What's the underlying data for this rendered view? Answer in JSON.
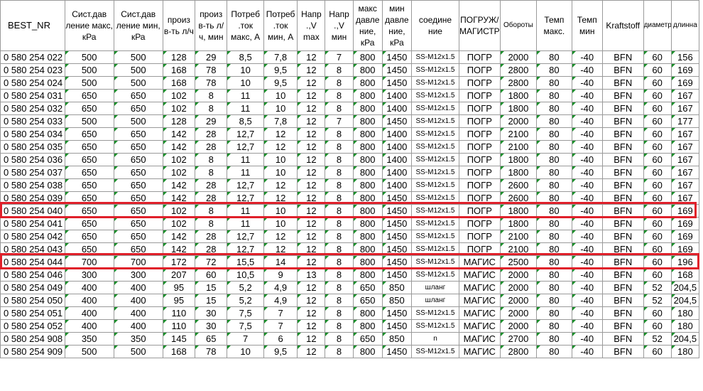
{
  "headers": [
    "BEST_NR",
    "Сист.дав ление макс, кРа",
    "Сист.дав ление мин, кРа",
    "произ в-ть л/ч",
    "произ в-ть л/ч, мин",
    "Потреб .ток макс, А",
    "Потреб .ток мин, А",
    "Напр .,V max",
    "Напр .,V мин",
    "макс давле ние, кРа",
    "мин давле ние, кРа",
    "соедине ние",
    "ПОГРУЖ/ МАГИСТР",
    "Обороты",
    "Темп макс.",
    "Темп мин",
    "Kraftstoff",
    "диаметр",
    "длинна"
  ],
  "rows": [
    [
      "0 580 254 022",
      "500",
      "500",
      "128",
      "29",
      "8,5",
      "7,8",
      "12",
      "7",
      "800",
      "1450",
      "SS-M12x1.5",
      "ПОГР",
      "2000",
      "80",
      "-40",
      "BFN",
      "60",
      "156"
    ],
    [
      "0 580 254 023",
      "500",
      "500",
      "168",
      "78",
      "10",
      "9,5",
      "12",
      "8",
      "800",
      "1450",
      "SS-M12x1.5",
      "ПОГР",
      "2800",
      "80",
      "-40",
      "BFN",
      "60",
      "169"
    ],
    [
      "0 580 254 024",
      "500",
      "500",
      "168",
      "78",
      "10",
      "9,5",
      "12",
      "8",
      "800",
      "1450",
      "SS-M12x1.5",
      "ПОГР",
      "2800",
      "80",
      "-40",
      "BFN",
      "60",
      "169"
    ],
    [
      "0 580 254 031",
      "650",
      "650",
      "102",
      "8",
      "11",
      "10",
      "12",
      "8",
      "800",
      "1400",
      "SS-M12x1.5",
      "ПОГР",
      "1800",
      "80",
      "-40",
      "BFN",
      "60",
      "167"
    ],
    [
      "0 580 254 032",
      "650",
      "650",
      "102",
      "8",
      "11",
      "10",
      "12",
      "8",
      "800",
      "1400",
      "SS-M12x1.5",
      "ПОГР",
      "1800",
      "80",
      "-40",
      "BFN",
      "60",
      "167"
    ],
    [
      "0 580 254 033",
      "500",
      "500",
      "128",
      "29",
      "8,5",
      "7,8",
      "12",
      "7",
      "800",
      "1450",
      "SS-M12x1.5",
      "ПОГР",
      "2000",
      "80",
      "-40",
      "BFN",
      "60",
      "177"
    ],
    [
      "0 580 254 034",
      "650",
      "650",
      "142",
      "28",
      "12,7",
      "12",
      "12",
      "8",
      "800",
      "1400",
      "SS-M12x1.5",
      "ПОГР",
      "2100",
      "80",
      "-40",
      "BFN",
      "60",
      "167"
    ],
    [
      "0 580 254 035",
      "650",
      "650",
      "142",
      "28",
      "12,7",
      "12",
      "12",
      "8",
      "800",
      "1400",
      "SS-M12x1.5",
      "ПОГР",
      "2100",
      "80",
      "-40",
      "BFN",
      "60",
      "167"
    ],
    [
      "0 580 254 036",
      "650",
      "650",
      "102",
      "8",
      "11",
      "10",
      "12",
      "8",
      "800",
      "1400",
      "SS-M12x1.5",
      "ПОГР",
      "1800",
      "80",
      "-40",
      "BFN",
      "60",
      "167"
    ],
    [
      "0 580 254 037",
      "650",
      "650",
      "102",
      "8",
      "11",
      "10",
      "12",
      "8",
      "800",
      "1400",
      "SS-M12x1.5",
      "ПОГР",
      "1800",
      "80",
      "-40",
      "BFN",
      "60",
      "167"
    ],
    [
      "0 580 254 038",
      "650",
      "650",
      "142",
      "28",
      "12,7",
      "12",
      "12",
      "8",
      "800",
      "1400",
      "SS-M12x1.5",
      "ПОГР",
      "2600",
      "80",
      "-40",
      "BFN",
      "60",
      "167"
    ],
    [
      "0 580 254 039",
      "650",
      "650",
      "142",
      "28",
      "12,7",
      "12",
      "12",
      "8",
      "800",
      "1450",
      "SS-M12x1.5",
      "ПОГР",
      "2600",
      "80",
      "-40",
      "BFN",
      "60",
      "167"
    ],
    [
      "0 580 254 040",
      "650",
      "650",
      "102",
      "8",
      "11",
      "10",
      "12",
      "8",
      "800",
      "1450",
      "SS-M12x1.5",
      "ПОГР",
      "1800",
      "80",
      "-40",
      "BFN",
      "60",
      "169"
    ],
    [
      "0 580 254 041",
      "650",
      "650",
      "102",
      "8",
      "11",
      "10",
      "12",
      "8",
      "800",
      "1450",
      "SS-M12x1.5",
      "ПОГР",
      "1800",
      "80",
      "-40",
      "BFN",
      "60",
      "169"
    ],
    [
      "0 580 254 042",
      "650",
      "650",
      "142",
      "28",
      "12,7",
      "12",
      "12",
      "8",
      "800",
      "1450",
      "SS-M12x1.5",
      "ПОГР",
      "2100",
      "80",
      "-40",
      "BFN",
      "60",
      "169"
    ],
    [
      "0 580 254 043",
      "650",
      "650",
      "142",
      "28",
      "12,7",
      "12",
      "12",
      "8",
      "800",
      "1450",
      "SS-M12x1.5",
      "ПОГР",
      "2100",
      "80",
      "-40",
      "BFN",
      "60",
      "169"
    ],
    [
      "0 580 254 044",
      "700",
      "700",
      "172",
      "72",
      "15,5",
      "14",
      "12",
      "8",
      "800",
      "1450",
      "SS-M12x1.5",
      "МАГИС",
      "2500",
      "80",
      "-40",
      "BFN",
      "60",
      "196"
    ],
    [
      "0 580 254 046",
      "300",
      "300",
      "207",
      "60",
      "10,5",
      "9",
      "13",
      "8",
      "800",
      "1450",
      "SS-M12x1.5",
      "МАГИС",
      "2000",
      "80",
      "-40",
      "BFN",
      "60",
      "168"
    ],
    [
      "0 580 254 049",
      "400",
      "400",
      "95",
      "15",
      "5,2",
      "4,9",
      "12",
      "8",
      "650",
      "850",
      "шланг",
      "МАГИС",
      "2000",
      "80",
      "-40",
      "BFN",
      "52",
      "204,5"
    ],
    [
      "0 580 254 050",
      "400",
      "400",
      "95",
      "15",
      "5,2",
      "4,9",
      "12",
      "8",
      "650",
      "850",
      "шланг",
      "МАГИС",
      "2000",
      "80",
      "-40",
      "BFN",
      "52",
      "204,5"
    ],
    [
      "0 580 254 051",
      "400",
      "400",
      "110",
      "30",
      "7,5",
      "7",
      "12",
      "8",
      "800",
      "1450",
      "SS-M12x1.5",
      "МАГИС",
      "2000",
      "80",
      "-40",
      "BFN",
      "60",
      "180"
    ],
    [
      "0 580 254 052",
      "400",
      "400",
      "110",
      "30",
      "7,5",
      "7",
      "12",
      "8",
      "800",
      "1450",
      "SS-M12x1.5",
      "МАГИС",
      "2000",
      "80",
      "-40",
      "BFN",
      "60",
      "180"
    ],
    [
      "0 580 254 908",
      "350",
      "350",
      "145",
      "65",
      "7",
      "6",
      "12",
      "8",
      "650",
      "850",
      "n",
      "МАГИС",
      "2700",
      "80",
      "-40",
      "BFN",
      "52",
      "204,5"
    ],
    [
      "0 580 254 909",
      "500",
      "500",
      "168",
      "78",
      "10",
      "9,5",
      "12",
      "8",
      "800",
      "1450",
      "SS-M12x1.5",
      "МАГИС",
      "2800",
      "80",
      "-40",
      "BFN",
      "60",
      "180"
    ]
  ],
  "highlight_color": "#e0202a",
  "highlighted_rows": [
    "0 580 254 040",
    "0 580 254 044"
  ],
  "cell_marker_color": "#1a8f2a"
}
